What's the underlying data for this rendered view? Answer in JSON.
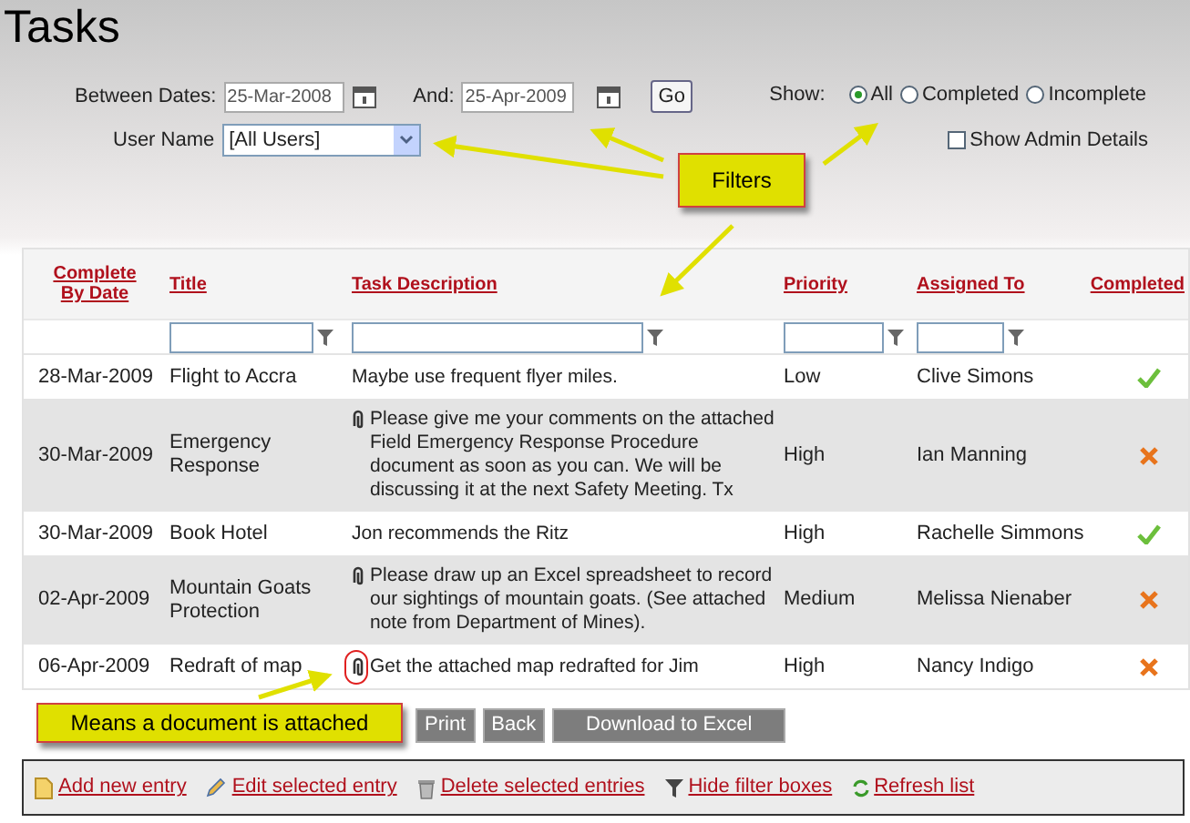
{
  "page": {
    "title": "Tasks"
  },
  "filters": {
    "between_label": "Between Dates:",
    "start_date": "25-Mar-2008",
    "and_label": "And:",
    "end_date": "25-Apr-2009",
    "go": "Go",
    "user_label": "User Name",
    "user_value": "[All Users]",
    "show_label": "Show:",
    "show_options": [
      {
        "label": "All",
        "selected": true
      },
      {
        "label": "Completed",
        "selected": false
      },
      {
        "label": "Incomplete",
        "selected": false
      }
    ],
    "admin": {
      "label": "Show Admin Details",
      "checked": false
    }
  },
  "table": {
    "columns": [
      {
        "label": "Complete By Date",
        "filter": false
      },
      {
        "label": "Title",
        "filter": true
      },
      {
        "label": "Task Description",
        "filter": true
      },
      {
        "label": "Priority",
        "filter": true
      },
      {
        "label": "Assigned To",
        "filter": true
      },
      {
        "label": "Completed",
        "filter": false
      }
    ],
    "rows": [
      {
        "date": "28-Mar-2009",
        "title": "Flight to Accra",
        "description": "Maybe use frequent flyer miles.",
        "attachment": false,
        "priority": "Low",
        "assigned": "Clive Simons",
        "completed": true
      },
      {
        "date": "30-Mar-2009",
        "title": "Emergency Response",
        "description": "Please give me your comments on the attached Field Emergency Response Procedure document as soon as you can. We will be discussing it at the next Safety Meeting. Tx",
        "attachment": true,
        "highlighted": false,
        "priority": "High",
        "assigned": "Ian Manning",
        "completed": false
      },
      {
        "date": "30-Mar-2009",
        "title": "Book Hotel",
        "description": "Jon recommends the Ritz",
        "attachment": false,
        "priority": "High",
        "assigned": "Rachelle Simmons",
        "completed": true
      },
      {
        "date": "02-Apr-2009",
        "title": "Mountain Goats Protection",
        "description": "Please draw up an Excel spreadsheet to record our sightings of mountain goats. (See attached note from Department of Mines).",
        "attachment": true,
        "highlighted": false,
        "priority": "Medium",
        "assigned": "Melissa Nienaber",
        "completed": false
      },
      {
        "date": "06-Apr-2009",
        "title": "Redraft of map",
        "description": "Get the attached map redrafted for Jim",
        "attachment": true,
        "highlighted": true,
        "priority": "High",
        "assigned": "Nancy Indigo",
        "completed": false
      }
    ]
  },
  "buttons": [
    "Print",
    "Back",
    "Download to Excel"
  ],
  "toolbar": [
    {
      "kind": "add",
      "label": "Add new entry"
    },
    {
      "kind": "edit",
      "label": "Edit selected entry"
    },
    {
      "kind": "delete",
      "label": "Delete selected entries"
    },
    {
      "kind": "filter",
      "label": "Hide filter boxes"
    },
    {
      "kind": "refresh",
      "label": "Refresh list"
    }
  ],
  "callouts": [
    "Filters",
    "Means a document is attached"
  ]
}
